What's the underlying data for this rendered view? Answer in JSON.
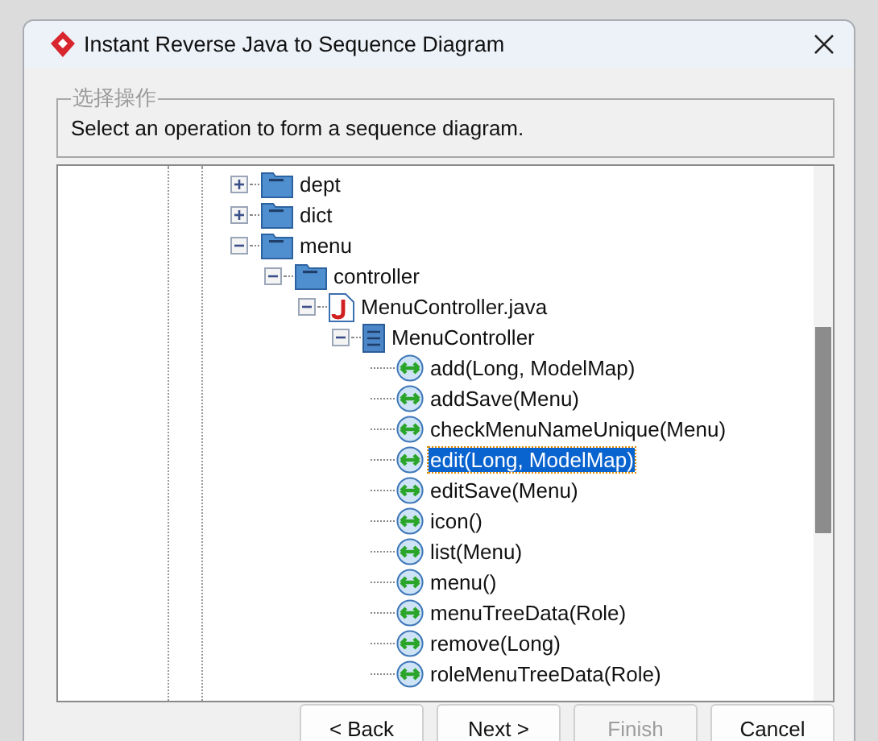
{
  "window": {
    "title": "Instant Reverse Java to Sequence Diagram"
  },
  "group": {
    "legend": "选择操作",
    "text": "Select an operation to form a sequence diagram."
  },
  "tree": [
    {
      "label": "dept",
      "kind": "package",
      "expanded": false,
      "selected": false
    },
    {
      "label": "dict",
      "kind": "package",
      "expanded": false,
      "selected": false
    },
    {
      "label": "menu",
      "kind": "package",
      "expanded": true,
      "selected": false,
      "children": [
        {
          "label": "controller",
          "kind": "package",
          "expanded": true,
          "selected": false,
          "children": [
            {
              "label": "MenuController.java",
              "kind": "java-file",
              "expanded": true,
              "selected": false,
              "children": [
                {
                  "label": "MenuController",
                  "kind": "class",
                  "expanded": true,
                  "selected": false,
                  "children": [
                    {
                      "label": "add(Long, ModelMap)",
                      "kind": "method",
                      "selected": false
                    },
                    {
                      "label": "addSave(Menu)",
                      "kind": "method",
                      "selected": false
                    },
                    {
                      "label": "checkMenuNameUnique(Menu)",
                      "kind": "method",
                      "selected": false
                    },
                    {
                      "label": "edit(Long, ModelMap)",
                      "kind": "method",
                      "selected": true
                    },
                    {
                      "label": "editSave(Menu)",
                      "kind": "method",
                      "selected": false
                    },
                    {
                      "label": "icon()",
                      "kind": "method",
                      "selected": false
                    },
                    {
                      "label": "list(Menu)",
                      "kind": "method",
                      "selected": false
                    },
                    {
                      "label": "menu()",
                      "kind": "method",
                      "selected": false
                    },
                    {
                      "label": "menuTreeData(Role)",
                      "kind": "method",
                      "selected": false
                    },
                    {
                      "label": "remove(Long)",
                      "kind": "method",
                      "selected": false
                    },
                    {
                      "label": "roleMenuTreeData(Role)",
                      "kind": "method",
                      "selected": false
                    }
                  ]
                }
              ]
            }
          ]
        }
      ]
    }
  ],
  "buttons": [
    {
      "label": "< Back",
      "disabled": false
    },
    {
      "label": "Next >",
      "disabled": false
    },
    {
      "label": "Finish",
      "disabled": true
    },
    {
      "label": "Cancel",
      "disabled": false
    }
  ]
}
